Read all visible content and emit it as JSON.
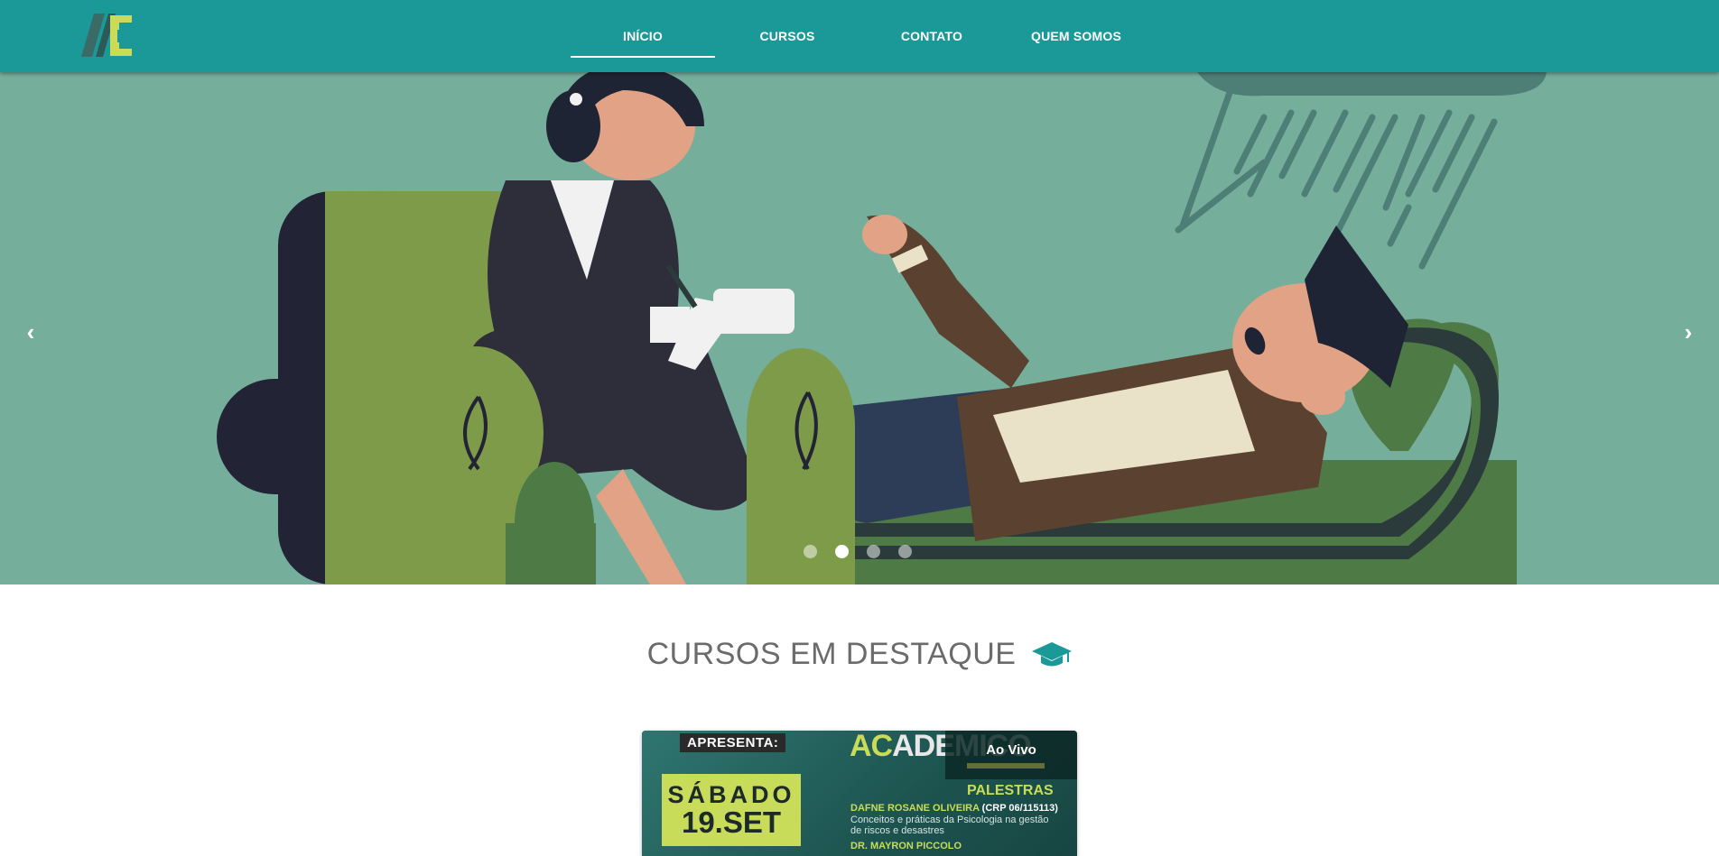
{
  "nav": {
    "items": [
      {
        "label": "INÍCIO",
        "active": true
      },
      {
        "label": "CURSOS",
        "active": false
      },
      {
        "label": "CONTATO",
        "active": false
      },
      {
        "label": "QUEM SOMOS",
        "active": false
      }
    ]
  },
  "carousel": {
    "prev_icon": "chevron-left-icon",
    "next_icon": "chevron-right-icon",
    "slides_count": 4,
    "active_slide": 2
  },
  "featured": {
    "title": "CURSOS EM DESTAQUE",
    "icon": "graduation-cap-icon"
  },
  "course_card": {
    "badge": "Ao Vivo",
    "poster": {
      "apresenta": "APRESENTA:",
      "day": "SÁBADO",
      "date": "19.SET",
      "brand_a": "AC",
      "brand_b": "ADEMICO",
      "section": "PALESTRAS",
      "speaker1": "DAFNE ROSANE OLIVEIRA",
      "speaker1_crp": "(CRP 06/115113)",
      "speaker1_desc": "Conceitos e práticas da Psicologia na gestão de riscos e desastres",
      "speaker2": "DR. MAYRON PICCOLO"
    }
  },
  "colors": {
    "topbar": "#1b9898",
    "hero_bg": "#76ae9c",
    "accent": "#c9dc5a"
  }
}
